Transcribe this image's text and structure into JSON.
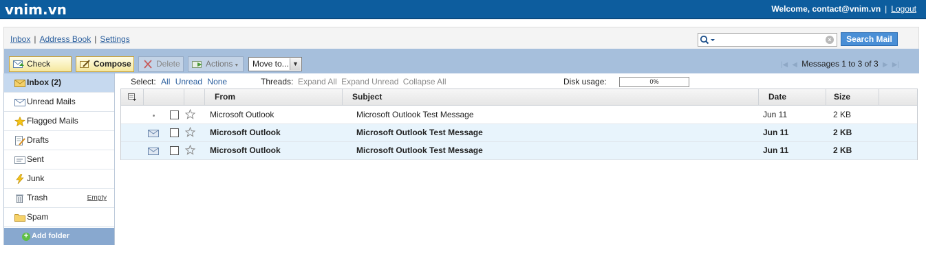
{
  "header": {
    "brand": "vnim.vn",
    "welcome": "Welcome, contact@vnim.vn",
    "separator": "|",
    "logout": "Logout"
  },
  "nav": {
    "inbox": "Inbox",
    "address_book": "Address Book",
    "settings": "Settings",
    "separator": "|"
  },
  "search": {
    "value": "",
    "button_label": "Search Mail"
  },
  "toolbar": {
    "check_mail": "Check Mail",
    "compose": "Compose",
    "delete": "Delete",
    "actions": "Actions",
    "move_to": "Move to...",
    "pager_text": "Messages 1 to 3 of 3"
  },
  "sidebar": {
    "folders": [
      {
        "label": "Inbox (2)",
        "icon": "inbox-icon",
        "active": true
      },
      {
        "label": "Unread Mails",
        "icon": "envelope-icon"
      },
      {
        "label": "Flagged Mails",
        "icon": "star-icon"
      },
      {
        "label": "Drafts",
        "icon": "drafts-icon"
      },
      {
        "label": "Sent",
        "icon": "sent-icon"
      },
      {
        "label": "Junk",
        "icon": "lightning-icon"
      },
      {
        "label": "Trash",
        "icon": "trash-icon",
        "action": "Empty"
      },
      {
        "label": "Spam",
        "icon": "folder-icon"
      }
    ],
    "add_folder": "Add folder"
  },
  "select": {
    "label": "Select:",
    "all": "All",
    "unread": "Unread",
    "none": "None"
  },
  "threads": {
    "label": "Threads:",
    "expand_all": "Expand All",
    "expand_unread": "Expand Unread",
    "collapse_all": "Collapse All"
  },
  "disk": {
    "label": "Disk usage:",
    "value": "0%",
    "fraction": 0
  },
  "table": {
    "columns": [
      "From",
      "Subject",
      "Date",
      "Size"
    ],
    "rows": [
      {
        "from": "Microsoft Outlook",
        "subject": "Microsoft Outlook Test Message",
        "date": "Jun 11",
        "size": "2 KB",
        "unread": false
      },
      {
        "from": "Microsoft Outlook",
        "subject": "Microsoft Outlook Test Message",
        "date": "Jun 11",
        "size": "2 KB",
        "unread": true
      },
      {
        "from": "Microsoft Outlook",
        "subject": "Microsoft Outlook Test Message",
        "date": "Jun 11",
        "size": "2 KB",
        "unread": true
      }
    ]
  },
  "colors": {
    "header_bg": "#0d5d9e",
    "toolbar_bg": "#a6bfdc",
    "unread_row": "#e8f4fc",
    "link": "#2b5f9e"
  }
}
